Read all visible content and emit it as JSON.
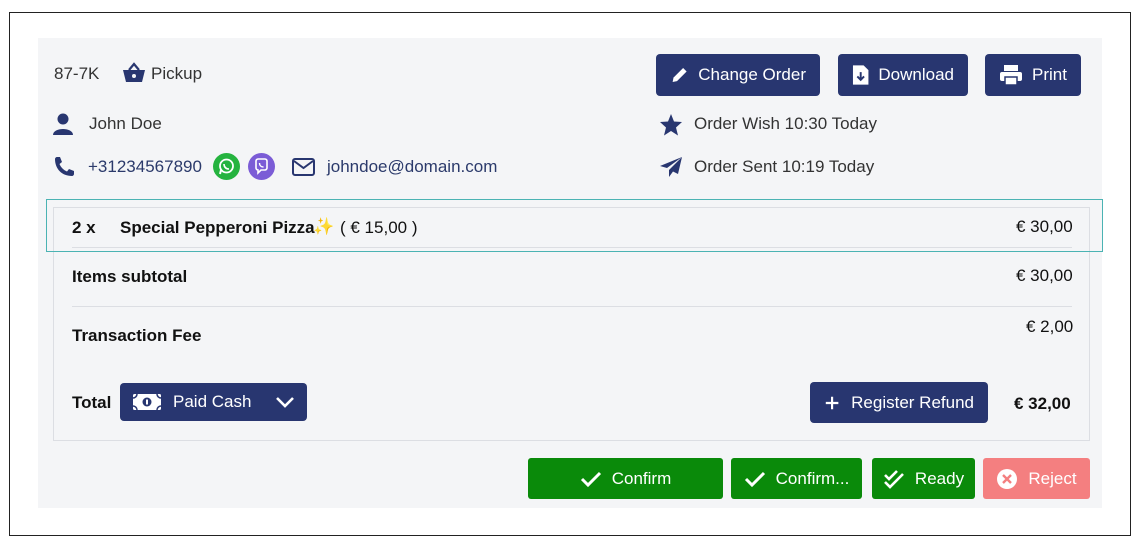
{
  "order": {
    "code": "87-7K",
    "type": "Pickup"
  },
  "customer": {
    "name": "John Doe",
    "phone": "+31234567890",
    "email": "johndoe@domain.com"
  },
  "header_buttons": {
    "change_order": "Change Order",
    "download": "Download",
    "print": "Print"
  },
  "timing": {
    "wish": "Order Wish 10:30 Today",
    "sent": "Order Sent 10:19 Today"
  },
  "items": [
    {
      "qty": "2 x",
      "name": "Special Pepperoni Pizza",
      "emoji": "✨",
      "unit_price": "( € 15,00 )",
      "total": "€ 30,00"
    }
  ],
  "summary": {
    "subtotal_label": "Items subtotal",
    "subtotal_value": "€ 30,00",
    "fee_label": "Transaction Fee",
    "fee_value": "€ 2,00",
    "total_label": "Total",
    "total_value": "€ 32,00",
    "payment_method": "Paid Cash",
    "register_refund": "Register Refund"
  },
  "actions": {
    "confirm": "Confirm",
    "confirm_more": "Confirm...",
    "ready": "Ready",
    "reject": "Reject"
  },
  "colors": {
    "navy": "#283670",
    "green": "#0a8a0a",
    "reject": "#f47f80",
    "whatsapp": "#25b33f",
    "viber": "#7b5cd6",
    "highlight": "#4bb3b3"
  }
}
